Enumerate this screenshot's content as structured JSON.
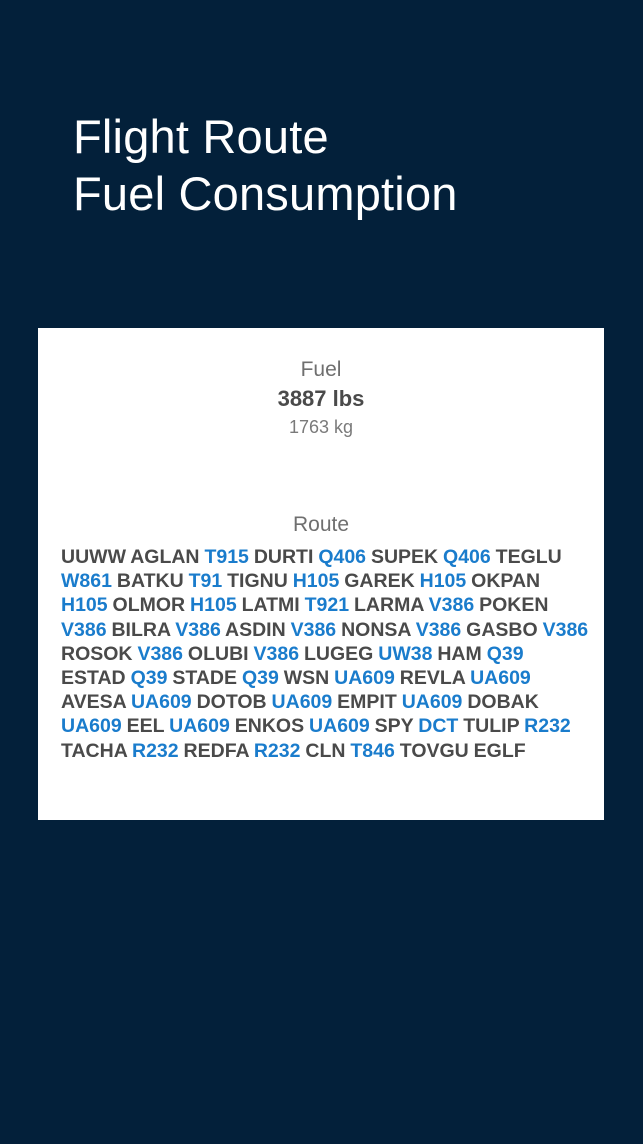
{
  "header": {
    "title_lines": [
      "Flight Route",
      "Fuel Consumption"
    ]
  },
  "colors": {
    "background": "#03203a",
    "card": "#ffffff",
    "waypoint": "#4a4a4a",
    "airway": "#1a7ccc"
  },
  "fuel": {
    "label": "Fuel",
    "lbs": "3887 lbs",
    "kg": "1763 kg"
  },
  "route": {
    "label": "Route",
    "tokens": [
      {
        "t": "UUWW",
        "k": "wp"
      },
      {
        "t": "AGLAN",
        "k": "wp"
      },
      {
        "t": "T915",
        "k": "aw"
      },
      {
        "t": "DURTI",
        "k": "wp"
      },
      {
        "t": "Q406",
        "k": "aw"
      },
      {
        "t": "SUPEK",
        "k": "wp"
      },
      {
        "t": "Q406",
        "k": "aw"
      },
      {
        "t": "TEGLU",
        "k": "wp"
      },
      {
        "t": "W861",
        "k": "aw"
      },
      {
        "t": "BATKU",
        "k": "wp"
      },
      {
        "t": "T91",
        "k": "aw"
      },
      {
        "t": "TIGNU",
        "k": "wp"
      },
      {
        "t": "H105",
        "k": "aw"
      },
      {
        "t": "GAREK",
        "k": "wp"
      },
      {
        "t": "H105",
        "k": "aw"
      },
      {
        "t": "OKPAN",
        "k": "wp"
      },
      {
        "t": "H105",
        "k": "aw"
      },
      {
        "t": "OLMOR",
        "k": "wp"
      },
      {
        "t": "H105",
        "k": "aw"
      },
      {
        "t": "LATMI",
        "k": "wp"
      },
      {
        "t": "T921",
        "k": "aw"
      },
      {
        "t": "LARMA",
        "k": "wp"
      },
      {
        "t": "V386",
        "k": "aw"
      },
      {
        "t": "POKEN",
        "k": "wp"
      },
      {
        "t": "V386",
        "k": "aw"
      },
      {
        "t": "BILRA",
        "k": "wp"
      },
      {
        "t": "V386",
        "k": "aw"
      },
      {
        "t": "ASDIN",
        "k": "wp"
      },
      {
        "t": "V386",
        "k": "aw"
      },
      {
        "t": "NONSA",
        "k": "wp"
      },
      {
        "t": "V386",
        "k": "aw"
      },
      {
        "t": "GASBO",
        "k": "wp"
      },
      {
        "t": "V386",
        "k": "aw"
      },
      {
        "t": "ROSOK",
        "k": "wp"
      },
      {
        "t": "V386",
        "k": "aw"
      },
      {
        "t": "OLUBI",
        "k": "wp"
      },
      {
        "t": "V386",
        "k": "aw"
      },
      {
        "t": "LUGEG",
        "k": "wp"
      },
      {
        "t": "UW38",
        "k": "aw"
      },
      {
        "t": "HAM",
        "k": "wp"
      },
      {
        "t": "Q39",
        "k": "aw"
      },
      {
        "t": "ESTAD",
        "k": "wp"
      },
      {
        "t": "Q39",
        "k": "aw"
      },
      {
        "t": "STADE",
        "k": "wp"
      },
      {
        "t": "Q39",
        "k": "aw"
      },
      {
        "t": "WSN",
        "k": "wp"
      },
      {
        "t": "UA609",
        "k": "aw"
      },
      {
        "t": "REVLA",
        "k": "wp"
      },
      {
        "t": "UA609",
        "k": "aw"
      },
      {
        "t": "AVESA",
        "k": "wp"
      },
      {
        "t": "UA609",
        "k": "aw"
      },
      {
        "t": "DOTOB",
        "k": "wp"
      },
      {
        "t": "UA609",
        "k": "aw"
      },
      {
        "t": "EMPIT",
        "k": "wp"
      },
      {
        "t": "UA609",
        "k": "aw"
      },
      {
        "t": "DOBAK",
        "k": "wp"
      },
      {
        "t": "UA609",
        "k": "aw"
      },
      {
        "t": "EEL",
        "k": "wp"
      },
      {
        "t": "UA609",
        "k": "aw"
      },
      {
        "t": "ENKOS",
        "k": "wp"
      },
      {
        "t": "UA609",
        "k": "aw"
      },
      {
        "t": "SPY",
        "k": "wp"
      },
      {
        "t": "DCT",
        "k": "aw"
      },
      {
        "t": "TULIP",
        "k": "wp"
      },
      {
        "t": "R232",
        "k": "aw"
      },
      {
        "t": "TACHA",
        "k": "wp"
      },
      {
        "t": "R232",
        "k": "aw"
      },
      {
        "t": "REDFA",
        "k": "wp"
      },
      {
        "t": "R232",
        "k": "aw"
      },
      {
        "t": "CLN",
        "k": "wp"
      },
      {
        "t": "T846",
        "k": "aw"
      },
      {
        "t": "TOVGU",
        "k": "wp"
      },
      {
        "t": "EGLF",
        "k": "wp"
      }
    ]
  }
}
